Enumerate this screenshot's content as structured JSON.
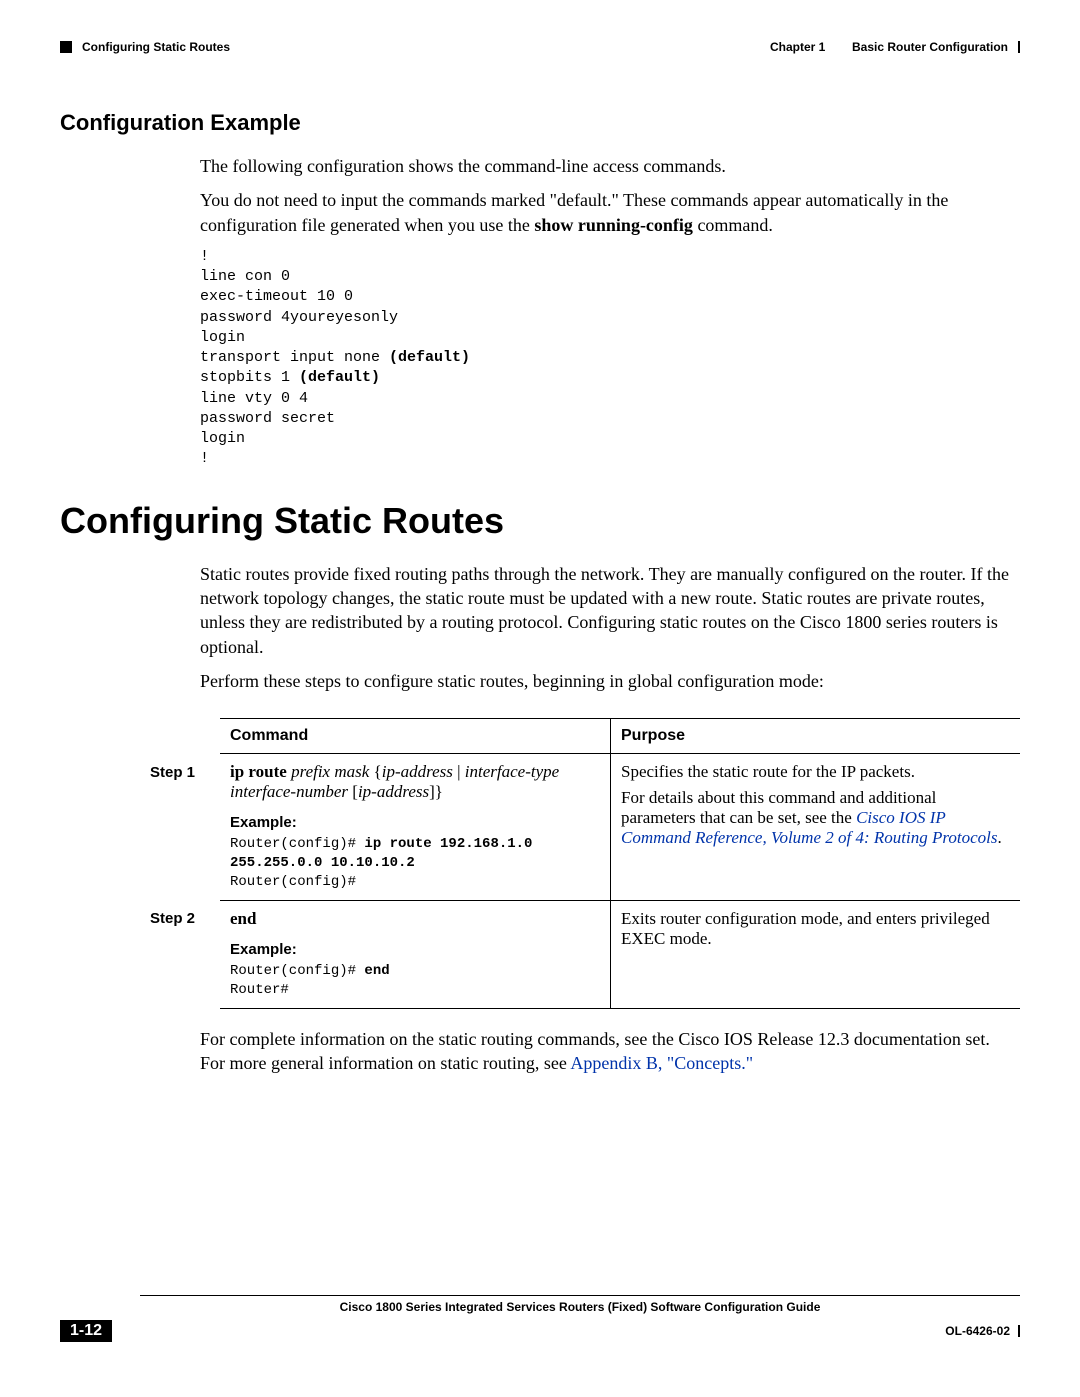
{
  "header": {
    "chapter_label": "Chapter 1",
    "chapter_title": "Basic Router Configuration",
    "section": "Configuring Static Routes"
  },
  "section1": {
    "heading": "Configuration Example",
    "para1": "The following configuration shows the command-line access commands.",
    "para2_pre": "You do not need to input the commands marked \"default.\" These commands appear automatically in the configuration file generated when you use the ",
    "para2_bold": "show running-config",
    "para2_post": " command.",
    "code": "!\nline con 0\nexec-timeout 10 0\npassword 4youreyesonly\nlogin\ntransport input none (default)\nstopbits 1 (default)\nline vty 0 4\npassword secret\nlogin\n!"
  },
  "section2": {
    "heading": "Configuring Static Routes",
    "para1": "Static routes provide fixed routing paths through the network. They are manually configured on the router. If the network topology changes, the static route must be updated with a new route. Static routes are private routes, unless they are redistributed by a routing protocol. Configuring static routes on the Cisco 1800 series routers is optional.",
    "para2": "Perform these steps to configure static routes, beginning in global configuration mode:"
  },
  "table": {
    "col_command": "Command",
    "col_purpose": "Purpose",
    "step1_label": "Step 1",
    "step1_cmd_b1": "ip route",
    "step1_cmd_i1": " prefix mask ",
    "step1_cmd_p1": "{",
    "step1_cmd_i2": "ip-address ",
    "step1_cmd_p2": "| ",
    "step1_cmd_i3": "interface-type interface-number ",
    "step1_cmd_p3": "[",
    "step1_cmd_i4": "ip-address",
    "step1_cmd_p4": "]}",
    "step1_example_label": "Example:",
    "step1_example_code": "Router(config)# ip route 192.168.1.0 \n255.255.0.0 10.10.10.2\nRouter(config)#",
    "step1_purpose_1": "Specifies the static route for the IP packets.",
    "step1_purpose_2_pre": "For details about this command and additional parameters that can be set, see the ",
    "step1_purpose_2_link": "Cisco IOS IP Command Reference, Volume 2 of 4: Routing Protocols",
    "step1_purpose_2_post": ".",
    "step2_label": "Step 2",
    "step2_cmd": "end",
    "step2_example_label": "Example:",
    "step2_example_code": "Router(config)# end\nRouter#",
    "step2_purpose": "Exits router configuration mode, and enters privileged EXEC mode."
  },
  "afterTable": {
    "text_pre": "For complete information on the static routing commands, see the Cisco IOS Release 12.3 documentation set. For more general information on static routing, see ",
    "link": "Appendix B, \"Concepts.\""
  },
  "footer": {
    "guide": "Cisco 1800 Series Integrated Services Routers (Fixed) Software Configuration Guide",
    "page": "1-12",
    "docid": "OL-6426-02"
  }
}
